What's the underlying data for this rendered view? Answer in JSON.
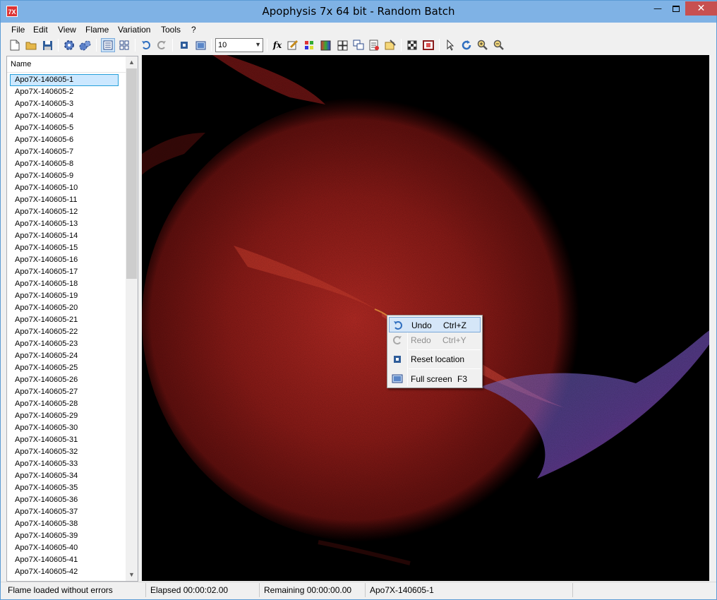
{
  "window": {
    "title": "Apophysis 7x 64 bit - Random Batch",
    "app_icon_text": "7X",
    "minimize": "—",
    "close": "✕"
  },
  "menu": [
    "File",
    "Edit",
    "View",
    "Flame",
    "Variation",
    "Tools",
    "?"
  ],
  "toolbar": {
    "combo_value": "10",
    "icons": [
      "new-icon",
      "open-icon",
      "save-icon",
      "render-icon",
      "render-all-icon",
      "list-view-icon",
      "icon-view-icon",
      "undo-icon",
      "redo-icon",
      "reset-location-icon",
      "full-screen-icon",
      "editor-icon",
      "adjust-icon",
      "palette-icon",
      "gradient-icon",
      "mutate-icon",
      "messages-icon",
      "script-icon",
      "options-icon",
      "transparency-icon",
      "film-icon",
      "select-icon",
      "rotate-icon",
      "zoom-in-icon",
      "zoom-out-icon"
    ]
  },
  "list": {
    "header": "Name",
    "items": [
      "Apo7X-140605-1",
      "Apo7X-140605-2",
      "Apo7X-140605-3",
      "Apo7X-140605-4",
      "Apo7X-140605-5",
      "Apo7X-140605-6",
      "Apo7X-140605-7",
      "Apo7X-140605-8",
      "Apo7X-140605-9",
      "Apo7X-140605-10",
      "Apo7X-140605-11",
      "Apo7X-140605-12",
      "Apo7X-140605-13",
      "Apo7X-140605-14",
      "Apo7X-140605-15",
      "Apo7X-140605-16",
      "Apo7X-140605-17",
      "Apo7X-140605-18",
      "Apo7X-140605-19",
      "Apo7X-140605-20",
      "Apo7X-140605-21",
      "Apo7X-140605-22",
      "Apo7X-140605-23",
      "Apo7X-140605-24",
      "Apo7X-140605-25",
      "Apo7X-140605-26",
      "Apo7X-140605-27",
      "Apo7X-140605-28",
      "Apo7X-140605-29",
      "Apo7X-140605-30",
      "Apo7X-140605-31",
      "Apo7X-140605-32",
      "Apo7X-140605-33",
      "Apo7X-140605-34",
      "Apo7X-140605-35",
      "Apo7X-140605-36",
      "Apo7X-140605-37",
      "Apo7X-140605-38",
      "Apo7X-140605-39",
      "Apo7X-140605-40",
      "Apo7X-140605-41",
      "Apo7X-140605-42"
    ],
    "selected_index": 0
  },
  "context_menu": {
    "undo": {
      "label": "Undo",
      "shortcut": "Ctrl+Z"
    },
    "redo": {
      "label": "Redo",
      "shortcut": "Ctrl+Y"
    },
    "reset": {
      "label": "Reset location"
    },
    "fullscreen": {
      "label": "Full screen",
      "shortcut": "F3"
    }
  },
  "status": {
    "message": "Flame loaded without errors",
    "elapsed": "Elapsed 00:00:02.00",
    "remaining": "Remaining 00:00:00.00",
    "flame_name": "Apo7X-140605-1"
  },
  "colors": {
    "flame_red": "#c0201c",
    "flame_blue": "#6a7fd8",
    "flame_magenta": "#c83cc8",
    "selection": "#cce8ff"
  }
}
